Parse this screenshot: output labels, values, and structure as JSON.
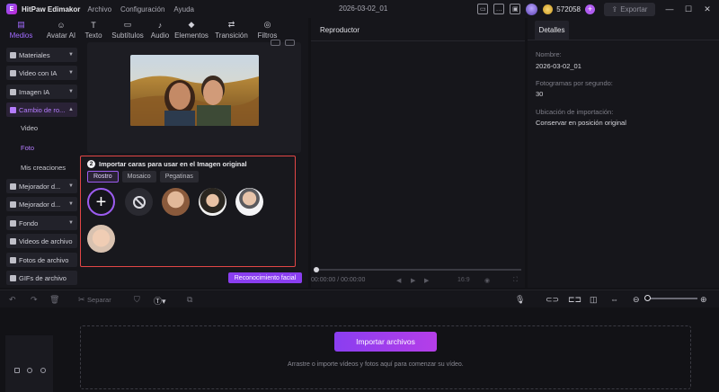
{
  "app": {
    "name": "HitPaw Edimakor",
    "project_title": "2026-03-02_01"
  },
  "menu": [
    "Archivo",
    "Configuración",
    "Ayuda"
  ],
  "header": {
    "credits": "572058",
    "export_label": "Exportar"
  },
  "tabs": [
    {
      "label": "Medios",
      "icon": "folder-icon"
    },
    {
      "label": "Avatar AI",
      "icon": "avatar-icon"
    },
    {
      "label": "Texto",
      "icon": "text-icon"
    },
    {
      "label": "Subtítulos",
      "icon": "subtitles-icon"
    },
    {
      "label": "Audio",
      "icon": "music-icon"
    },
    {
      "label": "Elementos",
      "icon": "elements-icon"
    },
    {
      "label": "Transición",
      "icon": "transition-icon"
    },
    {
      "label": "Filtros",
      "icon": "filter-icon"
    }
  ],
  "sidebar": {
    "items": [
      {
        "label": "Materiales"
      },
      {
        "label": "Video con IA"
      },
      {
        "label": "Imagen IA"
      },
      {
        "label": "Cambio de ro..."
      },
      {
        "label": "Mejorador d..."
      },
      {
        "label": "Mejorador d..."
      },
      {
        "label": "Fondo"
      },
      {
        "label": "Videos de archivo"
      },
      {
        "label": "Fotos de archivo"
      },
      {
        "label": "GIFs de archivo"
      }
    ],
    "subitems": [
      {
        "label": "Video"
      },
      {
        "label": "Foto"
      },
      {
        "label": "Mis creaciones"
      }
    ]
  },
  "face_panel": {
    "step": "2",
    "title": "Importar caras para usar en el Imagen original",
    "tabs": [
      "Rostro",
      "Mosaico",
      "Pegatinas"
    ],
    "add_symbol": "+",
    "recognize_button": "Reconocimiento facial"
  },
  "player": {
    "title": "Reproductor",
    "time": "00:00:00 / 00:00:00",
    "ratio": "16:9"
  },
  "details": {
    "tab": "Detalles",
    "fields": [
      {
        "label": "Nombre:",
        "value": "2026-03-02_01"
      },
      {
        "label": "Fotogramas por segundo:",
        "value": "30"
      },
      {
        "label": "Ubicación de importación:",
        "value": "Conservar en posición original"
      }
    ]
  },
  "timeline_toolbar": {
    "split_label": "Separar"
  },
  "timeline": {
    "import_button": "Importar archivos",
    "hint": "Arrastre o importe vídeos y fotos aquí para comenzar su vídeo."
  },
  "colors": {
    "accent": "#9c5cf0",
    "highlight_border": "#e24646",
    "background": "#121216"
  }
}
